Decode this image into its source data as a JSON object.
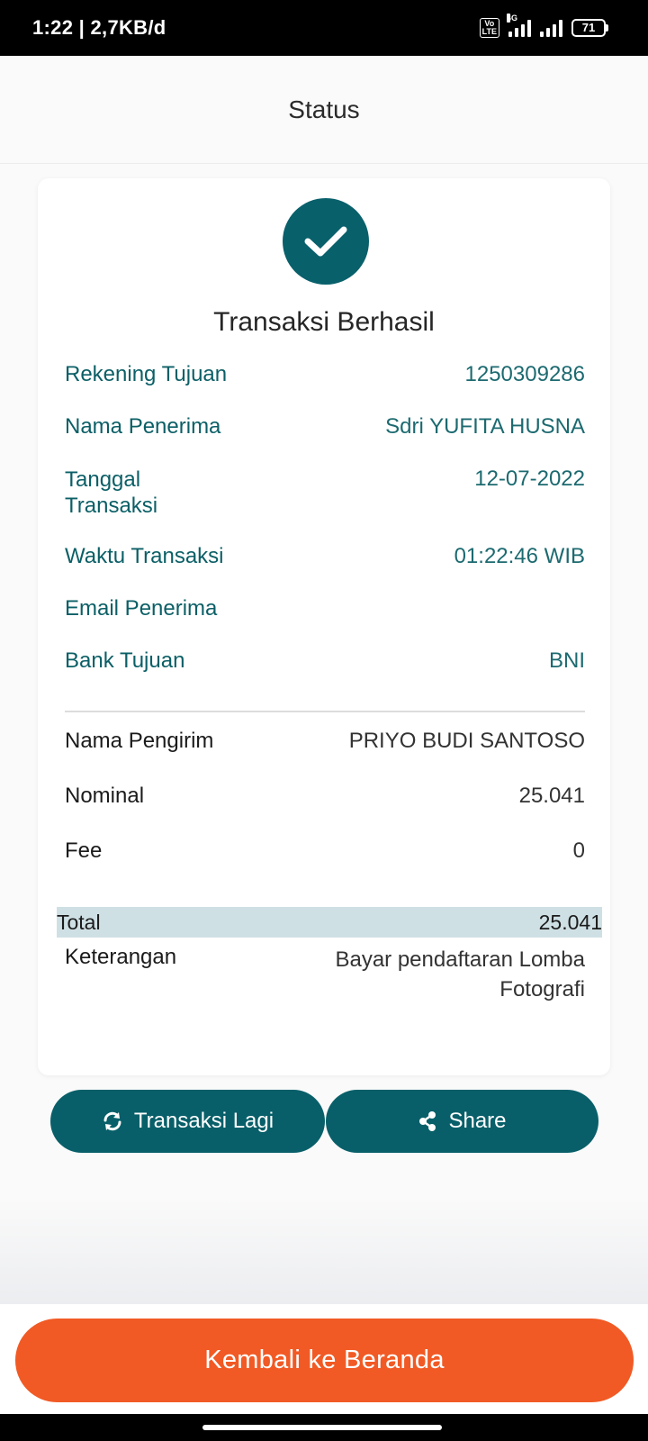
{
  "status_bar": {
    "time": "1:22 | 2,7KB/d",
    "volte": "Vo\nLTE",
    "network": "4G",
    "battery": "71"
  },
  "header": {
    "title": "Status"
  },
  "receipt": {
    "result_title": "Transaksi Berhasil",
    "details": [
      {
        "label": "Rekening Tujuan",
        "value": "1250309286"
      },
      {
        "label": "Nama Penerima",
        "value": "Sdri YUFITA HUSNA"
      },
      {
        "label": "Tanggal Transaksi",
        "value": "12-07-2022"
      },
      {
        "label": "Waktu Transaksi",
        "value": "01:22:46 WIB"
      },
      {
        "label": "Email Penerima",
        "value": ""
      },
      {
        "label": "Bank Tujuan",
        "value": "BNI"
      }
    ],
    "summary": [
      {
        "label": "Nama Pengirim",
        "value": "PRIYO BUDI SANTOSO"
      },
      {
        "label": "Nominal",
        "value": "25.041"
      },
      {
        "label": "Fee",
        "value": "0"
      }
    ],
    "total": {
      "label": "Total",
      "value": "25.041"
    },
    "note": {
      "label": "Keterangan",
      "value": "Bayar pendaftaran Lomba Fotografi"
    }
  },
  "actions": {
    "again_label": "Transaksi Lagi",
    "share_label": "Share",
    "home_label": "Kembali ke Beranda"
  },
  "colors": {
    "primary": "#085f69",
    "accent": "#f15a24",
    "total_highlight": "#cfe0e4"
  }
}
